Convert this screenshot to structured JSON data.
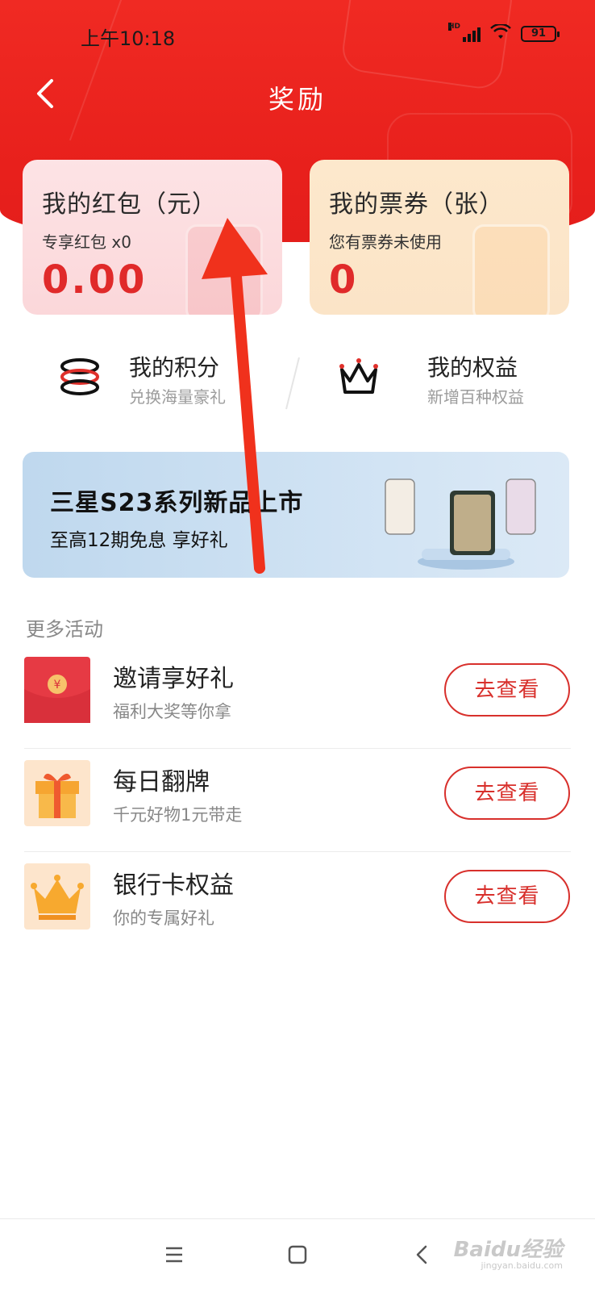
{
  "status_bar": {
    "time": "上午10:18",
    "network_label": "HD",
    "battery": "91"
  },
  "header": {
    "title": "奖励",
    "back_icon": "chevron-left-icon"
  },
  "cards": {
    "red_packet": {
      "title": "我的红包（元）",
      "subtitle": "专享红包 x0",
      "value": "0.00"
    },
    "tickets": {
      "title": "我的票券（张）",
      "subtitle": "您有票券未使用",
      "value": "0"
    }
  },
  "quick_entries": {
    "points": {
      "title": "我的积分",
      "subtitle": "兑换海量豪礼",
      "icon": "coins-stack-icon"
    },
    "rights": {
      "title": "我的权益",
      "subtitle": "新增百种权益",
      "icon": "crown-icon"
    }
  },
  "banner": {
    "title": "三星S23系列新品上市",
    "subtitle": "至高12期免息 享好礼"
  },
  "more_activities": {
    "section_title": "更多活动",
    "items": [
      {
        "title": "邀请享好礼",
        "subtitle": "福利大奖等你拿",
        "button": "去查看",
        "icon": "red-envelope-icon"
      },
      {
        "title": "每日翻牌",
        "subtitle": "千元好物1元带走",
        "button": "去查看",
        "icon": "gift-box-icon"
      },
      {
        "title": "银行卡权益",
        "subtitle": "你的专属好礼",
        "button": "去查看",
        "icon": "crown-icon"
      }
    ]
  },
  "watermark": {
    "brand": "Baidu经验",
    "url": "jingyan.baidu.com"
  },
  "colors": {
    "brand_red": "#e8201c",
    "button_red": "#d8302c",
    "red_card_bg": "#fde3e5",
    "orange_card_bg": "#fde8cc",
    "annotation_arrow": "#f0311c"
  }
}
